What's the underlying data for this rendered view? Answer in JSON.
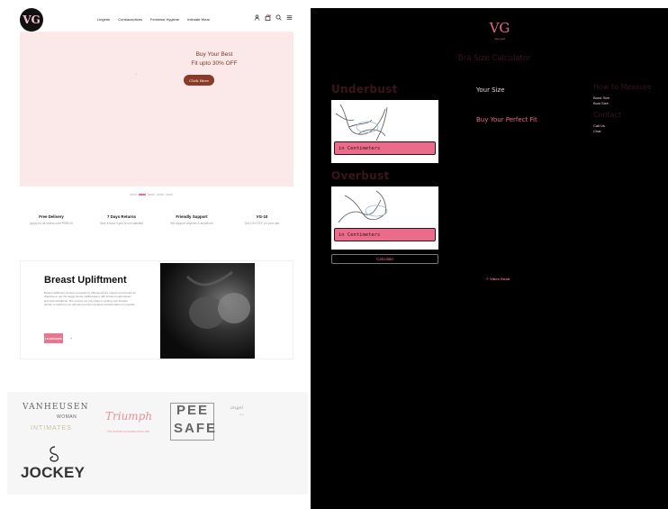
{
  "shop": {
    "logo": "VG",
    "nav": [
      "Lingerie",
      "Contraceptives",
      "Feminine Hygiene",
      "Intimate Wear"
    ],
    "icons": [
      "user-icon",
      "bag-icon",
      "search-icon",
      "menu-icon"
    ],
    "hero": {
      "line1": "Buy Your Best",
      "line2": "Fit upto 30% OFF",
      "button": "Click Here"
    },
    "slider_count": 5,
    "slider_active": 2,
    "features": [
      {
        "title": "Free Delivery",
        "sub": "Apply for all orders over ₹999.00"
      },
      {
        "title": "7 Days Returns",
        "sub": "Take it back if you're not satisfied"
      },
      {
        "title": "Friendly Support",
        "sub": "We support anytime & anywhere"
      },
      {
        "title": "VG-10",
        "sub": "Get 10% OFF on your cart"
      }
    ],
    "uplift": {
      "title": "Breast Upliftment",
      "body": "Breast Upliftment services provided by Vibesgood are majorly served with an objective to get the saggy breast uplifted along with breast to self-esteem and self-confidence. The service not only helps in getting your breasts perkier to uplift but you will also feel the complete transformation of yourself.",
      "button": "LEARN MORE",
      "arrow": "→"
    },
    "brands": {
      "vanheusen": "VANHEUSEN",
      "woman": "WOMAN",
      "intimates": "INTIMATES",
      "triumph": "Triumph",
      "triumph_tag": "THE SUPPORT OF WOMEN SINCE 1886",
      "peesafe_1": "PEE",
      "peesafe_2": "SAFE",
      "angel": "ángel",
      "angel_sub": "sexy",
      "jockey": "JOCKEY"
    },
    "colors": {
      "accent": "#e9768f",
      "hero_bg": "#fbe8e8",
      "hero_text": "#7a3a2c",
      "hero_button": "#8b3a28"
    }
  },
  "calc": {
    "logo": "VG",
    "logo_sub": "vibes good",
    "title": "Bra Size Calculator",
    "underbust": {
      "heading": "Underbust",
      "placeholder": "in Centimeters"
    },
    "overbust": {
      "heading": "Overbust",
      "placeholder": "in Centimeters"
    },
    "calculate": "Calculate",
    "your_size": "Your Size",
    "buy_fit": "Buy Your Perfect Fit",
    "how_to": {
      "heading": "How to Measure",
      "items": [
        "Band Size",
        "Bust Size"
      ]
    },
    "contact": {
      "heading": "Contact",
      "items": [
        "Call Us",
        "Chat"
      ]
    },
    "footer_prefix": "©",
    "footer_brand": "Vibes Good",
    "colors": {
      "bg": "#000000",
      "accent": "#ea6b8a",
      "heading": "#3d141e",
      "light": "#f2c9d3"
    }
  }
}
